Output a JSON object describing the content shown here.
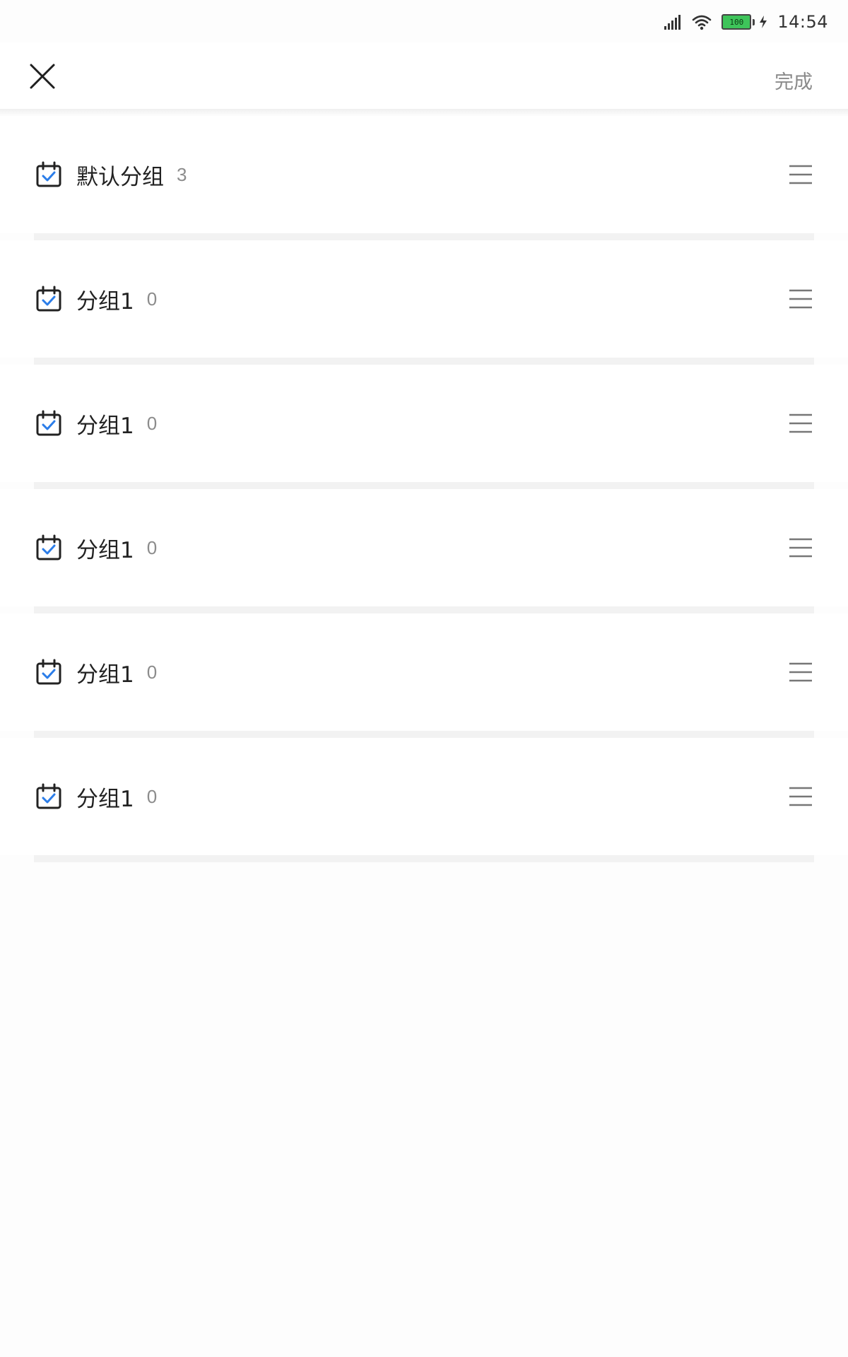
{
  "status_bar": {
    "time": "14:54",
    "battery_level": "100",
    "signal_icon": "signal-icon",
    "wifi_icon": "wifi-icon",
    "charging_icon": "charging-bolt-icon"
  },
  "header": {
    "close_icon": "close-icon",
    "done_label": "完成"
  },
  "colors": {
    "accent": "#2b7de9",
    "icon_dark": "#222222",
    "count_gray": "#8c8c8c",
    "done_gray": "#8a8a8a",
    "separator": "#f2f2f2",
    "battery_green": "#3ec45a"
  },
  "groups": [
    {
      "name": "默认分组",
      "count": "3",
      "icon": "calendar-check-icon",
      "handle_icon": "drag-handle-icon"
    },
    {
      "name": "分组1",
      "count": "0",
      "icon": "calendar-check-icon",
      "handle_icon": "drag-handle-icon"
    },
    {
      "name": "分组1",
      "count": "0",
      "icon": "calendar-check-icon",
      "handle_icon": "drag-handle-icon"
    },
    {
      "name": "分组1",
      "count": "0",
      "icon": "calendar-check-icon",
      "handle_icon": "drag-handle-icon"
    },
    {
      "name": "分组1",
      "count": "0",
      "icon": "calendar-check-icon",
      "handle_icon": "drag-handle-icon"
    },
    {
      "name": "分组1",
      "count": "0",
      "icon": "calendar-check-icon",
      "handle_icon": "drag-handle-icon"
    }
  ]
}
